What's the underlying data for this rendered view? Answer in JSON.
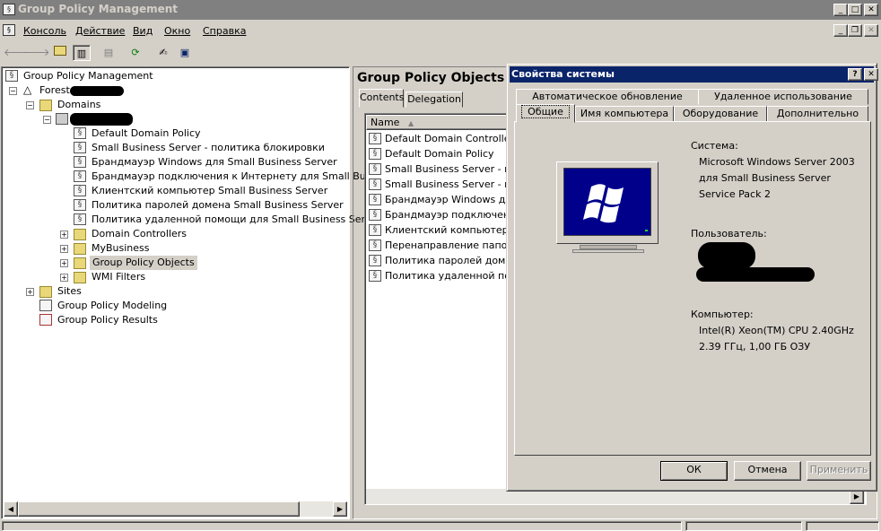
{
  "window": {
    "title": "Group Policy Management"
  },
  "menu": [
    {
      "label": "Консоль"
    },
    {
      "label": "Действие"
    },
    {
      "label": "Вид"
    },
    {
      "label": "Окно"
    },
    {
      "label": "Справка"
    }
  ],
  "tree": {
    "root": "Group Policy Management",
    "forest": "Forest:",
    "domains": "Domains",
    "domain_items": [
      "Default Domain Policy",
      "Small Business Server - политика блокировки",
      "Брандмауэр Windows для Small Business Server",
      "Брандмауэр подключения к Интернету для Small Business",
      "Клиентский компьютер Small Business Server",
      "Политика паролей домена Small Business Server",
      "Политика удаленной помощи для Small Business Server"
    ],
    "containers": [
      "Domain Controllers",
      "MyBusiness",
      "Group Policy Objects",
      "WMI Filters"
    ],
    "sites": "Sites",
    "modeling": "Group Policy Modeling",
    "results": "Group Policy Results"
  },
  "right_pane": {
    "title": "Group Policy Objects in",
    "tabs": [
      "Contents",
      "Delegation"
    ],
    "column_name": "Name",
    "rows": [
      "Default Domain Controllers P",
      "Default Domain Policy",
      "Small Business Server - пол",
      "Small Business Server - пол",
      "Брандмауэр Windows для",
      "Брандмауэр подключения",
      "Клиентский компьютер Sr",
      "Перенаправление папок д",
      "Политика паролей домена",
      "Политика удаленной помо"
    ]
  },
  "dialog": {
    "title": "Свойства системы",
    "tabs_row1": [
      "Автоматическое обновление",
      "Удаленное использование"
    ],
    "tabs_row2": [
      "Общие",
      "Имя компьютера",
      "Оборудование",
      "Дополнительно"
    ],
    "system_label": "Система:",
    "system_lines": [
      "Microsoft Windows Server 2003",
      "для Small Business Server",
      "Service Pack 2"
    ],
    "user_label": "Пользователь:",
    "computer_label": "Компьютер:",
    "computer_lines": [
      "Intel(R) Xeon(TM) CPU 2.40GHz",
      "2.39 ГГц, 1,00 ГБ ОЗУ"
    ],
    "ok": "ОК",
    "cancel": "Отмена",
    "apply": "Применить"
  },
  "colors": {
    "dialog_title_bg": "#0a246a",
    "window_title_bg": "#808080",
    "monitor_screen": "#00008b"
  }
}
